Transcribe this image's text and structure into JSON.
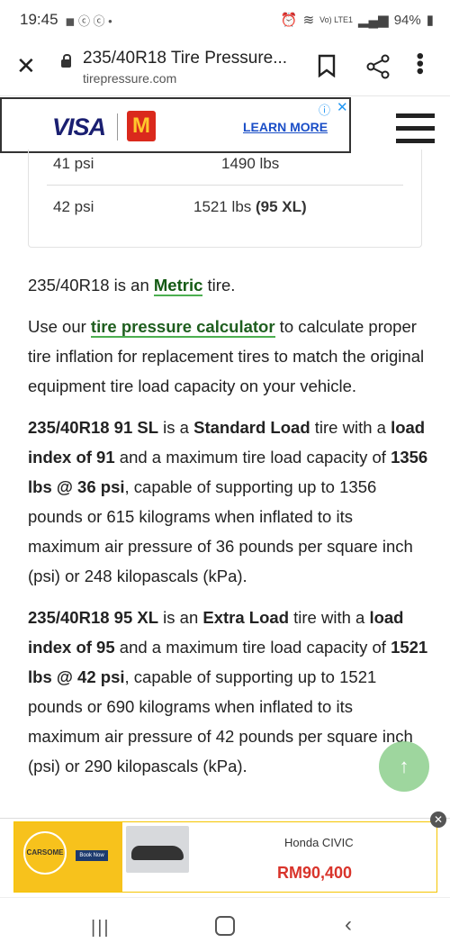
{
  "status_bar": {
    "time": "19:45",
    "battery": "94%",
    "network": "Vo) LTE1"
  },
  "topbar": {
    "title": "235/40R18 Tire Pressure...",
    "url": "tirepressure.com"
  },
  "ad_top": {
    "brand1": "VISA",
    "brand2": "M",
    "cta": "LEARN MORE"
  },
  "table": {
    "rows": [
      {
        "psi": "41 psi",
        "load": "1490 lbs"
      },
      {
        "psi": "42 psi",
        "load": "1521 lbs",
        "load_tag": "(95 XL)"
      }
    ]
  },
  "content": {
    "p1_pre": "235/40R18 is an ",
    "p1_link": "Metric",
    "p1_post": " tire.",
    "p2_pre": "Use our ",
    "p2_link": "tire pressure calculator",
    "p2_post": " to calculate proper tire inflation for replacement tires to match the original equipment tire load capacity on your vehicle.",
    "p3_b1": "235/40R18 91 SL",
    "p3_t1": " is a ",
    "p3_b2": "Standard Load",
    "p3_t2": " tire with a ",
    "p3_b3": "load index of 91",
    "p3_t3": " and a maximum tire load capacity of ",
    "p3_b4": "1356 lbs @ 36 psi",
    "p3_t4": ", capable of supporting up to 1356 pounds or 615 kilograms when inflated to its maximum air pressure of 36 pounds per square inch (psi) or 248 kilopascals (kPa).",
    "p4_b1": "235/40R18 95 XL",
    "p4_t1": " is an ",
    "p4_b2": "Extra Load",
    "p4_t2": " tire with a ",
    "p4_b3": "load index of 95",
    "p4_t3": " and a maximum tire load capacity of ",
    "p4_b4": "1521 lbs @ 42 psi",
    "p4_t4": ", capable of supporting up to 1521 pounds or 690 kilograms when inflated to its maximum air pressure of 42 pounds per square inch (psi) or 290 kilopascals (kPa)."
  },
  "ad_bottom": {
    "brand": "CARSOME",
    "button": "Book Now",
    "model": "Honda CIVIC",
    "price": "RM90,400"
  }
}
